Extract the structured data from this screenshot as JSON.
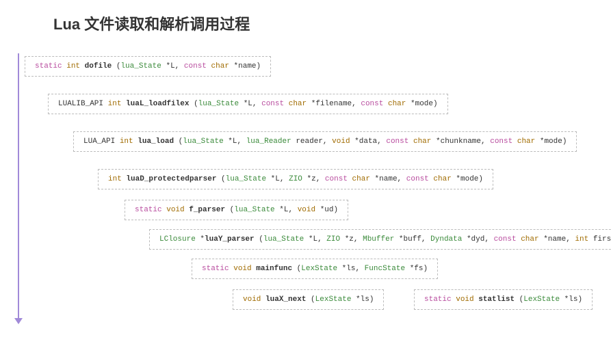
{
  "title": "Lua 文件读取和解析调用过程",
  "boxes": {
    "dofile": {
      "tokens": [
        {
          "cls": "kw-static",
          "t": "static"
        },
        {
          "cls": "punct",
          "t": " "
        },
        {
          "cls": "kw-int",
          "t": "int"
        },
        {
          "cls": "punct",
          "t": " "
        },
        {
          "cls": "fn-name",
          "t": "dofile"
        },
        {
          "cls": "punct",
          "t": " ("
        },
        {
          "cls": "kw-luastate",
          "t": "lua_State"
        },
        {
          "cls": "punct",
          "t": " *L, "
        },
        {
          "cls": "kw-const",
          "t": "const"
        },
        {
          "cls": "punct",
          "t": " "
        },
        {
          "cls": "kw-char",
          "t": "char"
        },
        {
          "cls": "punct",
          "t": " *name)"
        }
      ]
    },
    "luaL_loadfilex": {
      "tokens": [
        {
          "cls": "kw-api",
          "t": "LUALIB_API"
        },
        {
          "cls": "punct",
          "t": " "
        },
        {
          "cls": "kw-int",
          "t": "int"
        },
        {
          "cls": "punct",
          "t": " "
        },
        {
          "cls": "fn-name",
          "t": "luaL_loadfilex"
        },
        {
          "cls": "punct",
          "t": " ("
        },
        {
          "cls": "kw-luastate",
          "t": "lua_State"
        },
        {
          "cls": "punct",
          "t": " *L, "
        },
        {
          "cls": "kw-const",
          "t": "const"
        },
        {
          "cls": "punct",
          "t": " "
        },
        {
          "cls": "kw-char",
          "t": "char"
        },
        {
          "cls": "punct",
          "t": " *filename, "
        },
        {
          "cls": "kw-const",
          "t": "const"
        },
        {
          "cls": "punct",
          "t": " "
        },
        {
          "cls": "kw-char",
          "t": "char"
        },
        {
          "cls": "punct",
          "t": " *mode)"
        }
      ]
    },
    "lua_load": {
      "tokens": [
        {
          "cls": "kw-api",
          "t": "LUA_API"
        },
        {
          "cls": "punct",
          "t": " "
        },
        {
          "cls": "kw-int",
          "t": "int"
        },
        {
          "cls": "punct",
          "t": " "
        },
        {
          "cls": "fn-name",
          "t": "lua_load"
        },
        {
          "cls": "punct",
          "t": " ("
        },
        {
          "cls": "kw-luastate",
          "t": "lua_State"
        },
        {
          "cls": "punct",
          "t": " *L, "
        },
        {
          "cls": "kw-luareader",
          "t": "lua_Reader"
        },
        {
          "cls": "punct",
          "t": " reader, "
        },
        {
          "cls": "kw-void",
          "t": "void"
        },
        {
          "cls": "punct",
          "t": " *data, "
        },
        {
          "cls": "kw-const",
          "t": "const"
        },
        {
          "cls": "punct",
          "t": " "
        },
        {
          "cls": "kw-char",
          "t": "char"
        },
        {
          "cls": "punct",
          "t": " *chunkname, "
        },
        {
          "cls": "kw-const",
          "t": "const"
        },
        {
          "cls": "punct",
          "t": " "
        },
        {
          "cls": "kw-char",
          "t": "char"
        },
        {
          "cls": "punct",
          "t": " *mode)"
        }
      ]
    },
    "luaD_protectedparser": {
      "tokens": [
        {
          "cls": "kw-int",
          "t": "int"
        },
        {
          "cls": "punct",
          "t": " "
        },
        {
          "cls": "fn-name",
          "t": "luaD_protectedparser"
        },
        {
          "cls": "punct",
          "t": " ("
        },
        {
          "cls": "kw-luastate",
          "t": "lua_State"
        },
        {
          "cls": "punct",
          "t": " *L, "
        },
        {
          "cls": "kw-zio",
          "t": "ZIO"
        },
        {
          "cls": "punct",
          "t": " *z, "
        },
        {
          "cls": "kw-const",
          "t": "const"
        },
        {
          "cls": "punct",
          "t": " "
        },
        {
          "cls": "kw-char",
          "t": "char"
        },
        {
          "cls": "punct",
          "t": " *name, "
        },
        {
          "cls": "kw-const",
          "t": "const"
        },
        {
          "cls": "punct",
          "t": " "
        },
        {
          "cls": "kw-char",
          "t": "char"
        },
        {
          "cls": "punct",
          "t": " *mode)"
        }
      ]
    },
    "f_parser": {
      "tokens": [
        {
          "cls": "kw-static",
          "t": "static"
        },
        {
          "cls": "punct",
          "t": " "
        },
        {
          "cls": "kw-void",
          "t": "void"
        },
        {
          "cls": "punct",
          "t": " "
        },
        {
          "cls": "fn-name",
          "t": "f_parser"
        },
        {
          "cls": "punct",
          "t": " ("
        },
        {
          "cls": "kw-luastate",
          "t": "lua_State"
        },
        {
          "cls": "punct",
          "t": " *L, "
        },
        {
          "cls": "kw-void",
          "t": "void"
        },
        {
          "cls": "punct",
          "t": " *ud)"
        }
      ]
    },
    "luaY_parser": {
      "tokens": [
        {
          "cls": "kw-lclosure",
          "t": "LClosure"
        },
        {
          "cls": "punct",
          "t": " *"
        },
        {
          "cls": "fn-name",
          "t": "luaY_parser"
        },
        {
          "cls": "punct",
          "t": " ("
        },
        {
          "cls": "kw-luastate",
          "t": "lua_State"
        },
        {
          "cls": "punct",
          "t": " *L, "
        },
        {
          "cls": "kw-zio",
          "t": "ZIO"
        },
        {
          "cls": "punct",
          "t": " *z, "
        },
        {
          "cls": "kw-mbuffer",
          "t": "Mbuffer"
        },
        {
          "cls": "punct",
          "t": " *buff, "
        },
        {
          "cls": "kw-dyndata",
          "t": "Dyndata"
        },
        {
          "cls": "punct",
          "t": " *dyd, "
        },
        {
          "cls": "kw-const",
          "t": "const"
        },
        {
          "cls": "punct",
          "t": " "
        },
        {
          "cls": "kw-char",
          "t": "char"
        },
        {
          "cls": "punct",
          "t": " *name, "
        },
        {
          "cls": "kw-int",
          "t": "int"
        },
        {
          "cls": "punct",
          "t": " firstchar)"
        }
      ]
    },
    "mainfunc": {
      "tokens": [
        {
          "cls": "kw-static",
          "t": "static"
        },
        {
          "cls": "punct",
          "t": " "
        },
        {
          "cls": "kw-void",
          "t": "void"
        },
        {
          "cls": "punct",
          "t": " "
        },
        {
          "cls": "fn-name",
          "t": "mainfunc"
        },
        {
          "cls": "punct",
          "t": " ("
        },
        {
          "cls": "kw-lexstate",
          "t": "LexState"
        },
        {
          "cls": "punct",
          "t": " *ls, "
        },
        {
          "cls": "kw-funcstate",
          "t": "FuncState"
        },
        {
          "cls": "punct",
          "t": " *fs)"
        }
      ]
    },
    "luaX_next": {
      "tokens": [
        {
          "cls": "kw-void",
          "t": "void"
        },
        {
          "cls": "punct",
          "t": " "
        },
        {
          "cls": "fn-name",
          "t": "luaX_next"
        },
        {
          "cls": "punct",
          "t": " ("
        },
        {
          "cls": "kw-lexstate",
          "t": "LexState"
        },
        {
          "cls": "punct",
          "t": " *ls)"
        }
      ]
    },
    "statlist": {
      "tokens": [
        {
          "cls": "kw-static",
          "t": "static"
        },
        {
          "cls": "punct",
          "t": " "
        },
        {
          "cls": "kw-void",
          "t": "void"
        },
        {
          "cls": "punct",
          "t": " "
        },
        {
          "cls": "fn-name",
          "t": "statlist"
        },
        {
          "cls": "punct",
          "t": " ("
        },
        {
          "cls": "kw-lexstate",
          "t": "LexState"
        },
        {
          "cls": "punct",
          "t": " *ls)"
        }
      ]
    }
  }
}
